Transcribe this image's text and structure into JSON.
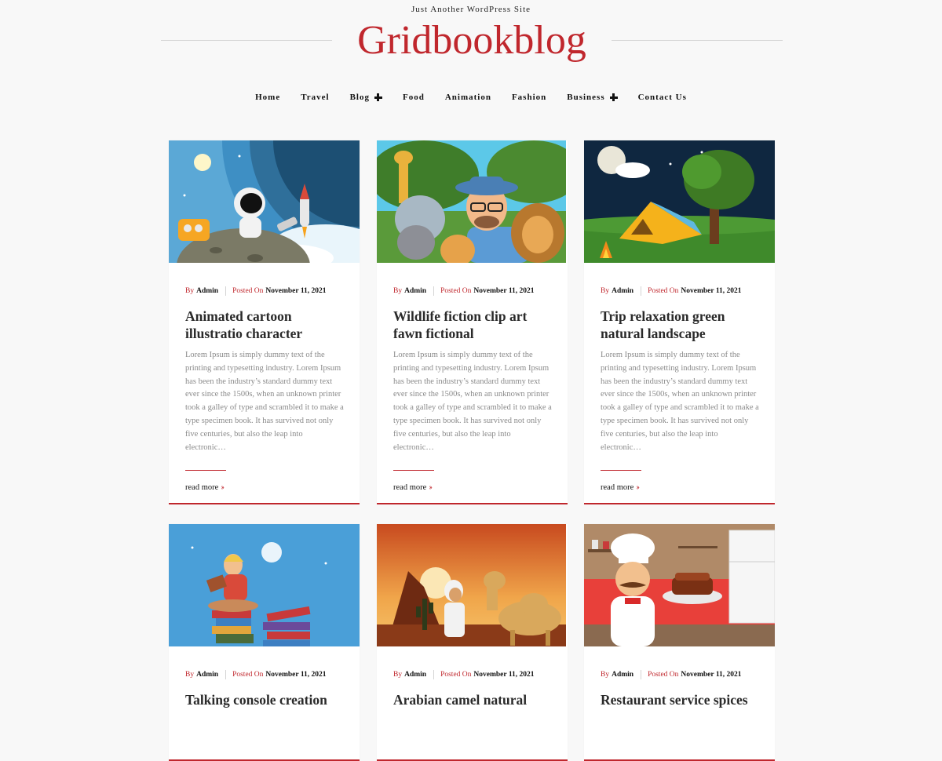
{
  "site": {
    "tagline": "Just Another WordPress Site",
    "title": "Gridbookblog"
  },
  "nav": {
    "items": [
      {
        "label": "Home"
      },
      {
        "label": "Travel"
      },
      {
        "label": "Blog",
        "has_sub": true
      },
      {
        "label": "Food"
      },
      {
        "label": "Animation"
      },
      {
        "label": "Fashion"
      },
      {
        "label": "Business",
        "has_sub": true
      },
      {
        "label": "Contact Us"
      }
    ]
  },
  "colors": {
    "accent": "#c0272d",
    "background": "#f8f8f8"
  },
  "posts": [
    {
      "by_label": "By",
      "author": "Admin",
      "posted_label": "Posted On",
      "date": "November 11, 2021",
      "title": "Animated cartoon illustratio character",
      "excerpt": "Lorem Ipsum is simply dummy text of the printing and typesetting industry. Lorem Ipsum has been the industry’s standard dummy text ever since the 1500s, when an unknown printer took a galley of type and scrambled it to make a type specimen book. It has survived not only five centuries, but also the leap into electronic…",
      "read_more": "read more",
      "image": "astronaut-illustration"
    },
    {
      "by_label": "By",
      "author": "Admin",
      "posted_label": "Posted On",
      "date": "November 11, 2021",
      "title": "Wildlife fiction clip art fawn fictional",
      "excerpt": "Lorem Ipsum is simply dummy text of the printing and typesetting industry. Lorem Ipsum has been the industry’s standard dummy text ever since the 1500s, when an unknown printer took a galley of type and scrambled it to make a type specimen book. It has survived not only five centuries, but also the leap into electronic…",
      "read_more": "read more",
      "image": "wildlife-illustration"
    },
    {
      "by_label": "By",
      "author": "Admin",
      "posted_label": "Posted On",
      "date": "November 11, 2021",
      "title": "Trip relaxation green natural landscape",
      "excerpt": "Lorem Ipsum is simply dummy text of the printing and typesetting industry. Lorem Ipsum has been the industry’s standard dummy text ever since the 1500s, when an unknown printer took a galley of type and scrambled it to make a type specimen book. It has survived not only five centuries, but also the leap into electronic…",
      "read_more": "read more",
      "image": "camping-illustration"
    },
    {
      "by_label": "By",
      "author": "Admin",
      "posted_label": "Posted On",
      "date": "November 11, 2021",
      "title": "Talking console creation",
      "image": "reading-illustration"
    },
    {
      "by_label": "By",
      "author": "Admin",
      "posted_label": "Posted On",
      "date": "November 11, 2021",
      "title": "Arabian camel natural",
      "image": "desert-camel-illustration"
    },
    {
      "by_label": "By",
      "author": "Admin",
      "posted_label": "Posted On",
      "date": "November 11, 2021",
      "title": "Restaurant service spices",
      "image": "chef-illustration"
    }
  ]
}
